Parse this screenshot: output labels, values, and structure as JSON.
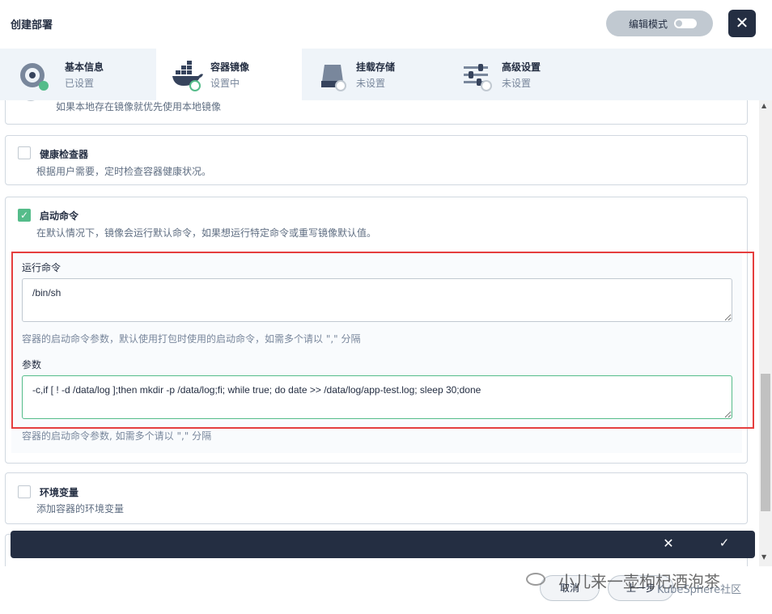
{
  "header": {
    "title": "创建部署",
    "edit_mode_label": "编辑模式",
    "close_icon": "close-icon"
  },
  "tabs": [
    {
      "name": "基本信息",
      "status": "已设置",
      "icon": "disc-icon"
    },
    {
      "name": "容器镜像",
      "status": "设置中",
      "icon": "docker-icon"
    },
    {
      "name": "挂载存储",
      "status": "未设置",
      "icon": "storage-icon"
    },
    {
      "name": "高级设置",
      "status": "未设置",
      "icon": "sliders-icon"
    }
  ],
  "cards": {
    "local_image": {
      "desc": "如果本地存在镜像就优先使用本地镜像"
    },
    "health_check": {
      "title": "健康检查器",
      "desc": "根据用户需要，定时检查容器健康状况。",
      "checked": false
    },
    "start_command": {
      "title": "启动命令",
      "desc": "在默认情况下，镜像会运行默认命令，如果想运行特定命令或重写镜像默认值。",
      "checked": true,
      "run_command_label": "运行命令",
      "run_command_value": "/bin/sh",
      "run_command_hint": "容器的启动命令参数，默认使用打包时使用的启动命令，如需多个请以 \",\" 分隔",
      "args_label": "参数",
      "args_value": "-c,if [ ! -d /data/log ];then mkdir -p /data/log;fi; while true; do date >> /data/log/app-test.log; sleep 30;done",
      "args_hint": "容器的启动命令参数, 如需多个请以 \",\" 分隔"
    },
    "env": {
      "title": "环境变量",
      "desc": "添加容器的环境变量",
      "checked": false
    }
  },
  "bottom_bar": {
    "cancel_symbol": "✕",
    "confirm_symbol": "✓"
  },
  "footer": {
    "cancel_label": "取消",
    "prev_label": "上一步",
    "watermark": "小儿来一壶枸杞酒泡茶",
    "watermark_sub": "KubeSphere社区"
  },
  "colors": {
    "accent_green": "#55bc8a",
    "dark": "#242e42",
    "highlight_red": "#e53e3e"
  }
}
